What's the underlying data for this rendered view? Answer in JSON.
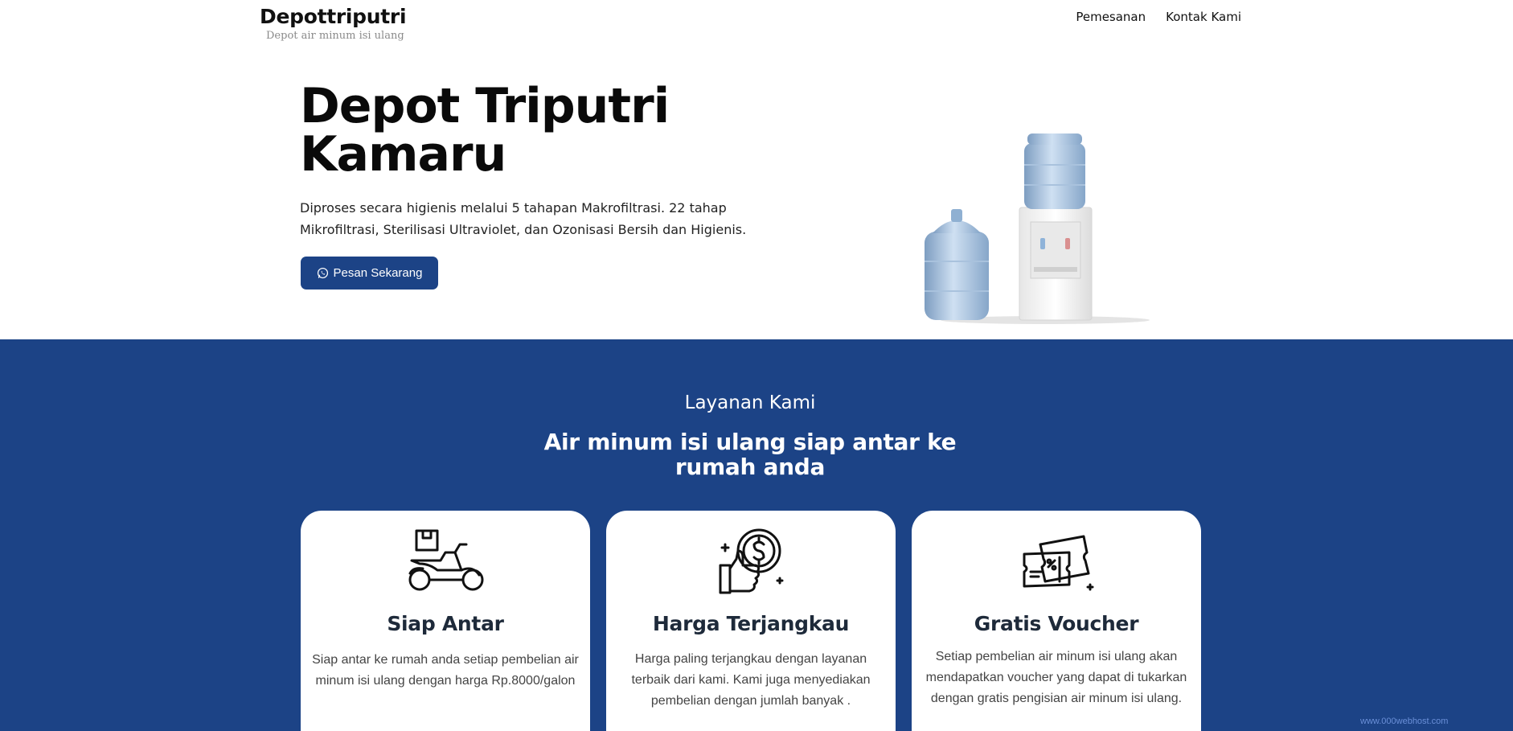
{
  "header": {
    "brand_name": "Depottriputri",
    "brand_tagline": "Depot air minum isi ulang",
    "nav": [
      {
        "label": "Pemesanan"
      },
      {
        "label": "Kontak Kami"
      }
    ]
  },
  "hero": {
    "title": "Depot Triputri Kamaru",
    "description": "Diproses secara higienis melalui 5 tahapan Makrofiltrasi. 22 tahap Mikrofiltrasi, Sterilisasi Ultraviolet, dan Ozonisasi Bersih dan Higienis.",
    "cta_label": "Pesan Sekarang",
    "cta_icon": "whatsapp-icon",
    "illustration": "water-dispenser-with-galons"
  },
  "services": {
    "eyebrow": "Layanan Kami",
    "heading": "Air minum isi ulang siap antar ke rumah anda",
    "cards": [
      {
        "icon": "delivery-scooter-icon",
        "title": "Siap Antar",
        "text": "Siap antar ke rumah anda setiap pembelian air minum isi ulang dengan harga Rp.8000/galon"
      },
      {
        "icon": "affordable-price-icon",
        "title": "Harga Terjangkau",
        "text": "Harga paling terjangkau dengan layanan terbaik dari kami. Kami juga menyediakan pembelian dengan jumlah banyak ."
      },
      {
        "icon": "voucher-icon",
        "title": "Gratis Voucher",
        "text": "Setiap pembelian air minum isi ulang akan mendapatkan voucher yang dapat di tukarkan dengan gratis pengisian air minum isi ulang."
      }
    ]
  },
  "colors": {
    "primary": "#1c4386",
    "card_bg": "#ffffff",
    "title_dark": "#1e2a3a"
  },
  "footer_badge": "www.000webhost.com"
}
